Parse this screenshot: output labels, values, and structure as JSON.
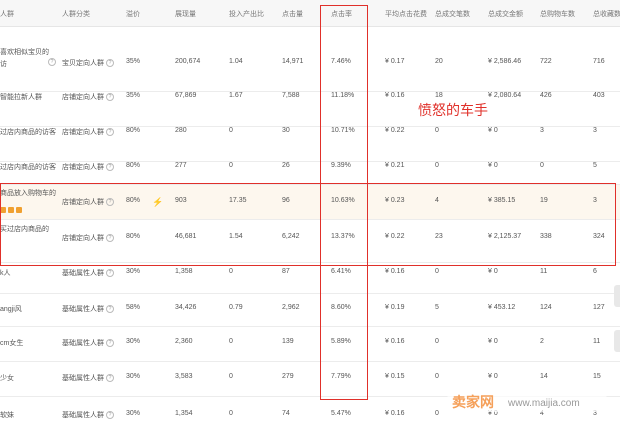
{
  "headers": {
    "audience": "人群",
    "audience_type": "人群分类",
    "premium": "溢价",
    "impressions": "展现量",
    "roi": "投入产出比",
    "clicks": "点击量",
    "ctr": "点击率",
    "avg_cpc": "平均点击花费",
    "total_deals": "总成交笔数",
    "total_amount": "总成交金额",
    "total_cart": "总购物车数",
    "total_fav": "总收藏数"
  },
  "rows": [
    {
      "name1": "喜欢相似宝贝的",
      "name2": "访",
      "type": "宝贝定向人群",
      "premium": "35%",
      "impressions": "200,674",
      "roi": "1.04",
      "clicks": "14,971",
      "ctr": "7.46%",
      "cpc": "¥ 0.17",
      "deals": "20",
      "amount": "¥ 2,586.46",
      "cart": "722",
      "fav": "716"
    },
    {
      "name1": "智能拉新人群",
      "name2": "",
      "type": "店铺定向人群",
      "premium": "35%",
      "impressions": "67,869",
      "roi": "1.67",
      "clicks": "7,588",
      "ctr": "11.18%",
      "cpc": "¥ 0.16",
      "deals": "18",
      "amount": "¥ 2,080.64",
      "cart": "426",
      "fav": "403"
    },
    {
      "name1": "过店内商品的访客",
      "name2": "",
      "type": "店铺定向人群",
      "premium": "80%",
      "impressions": "280",
      "roi": "0",
      "clicks": "30",
      "ctr": "10.71%",
      "cpc": "¥ 0.22",
      "deals": "0",
      "amount": "¥ 0",
      "cart": "3",
      "fav": "3"
    },
    {
      "name1": "过店内商品的访客",
      "name2": "",
      "type": "店铺定向人群",
      "premium": "80%",
      "impressions": "277",
      "roi": "0",
      "clicks": "26",
      "ctr": "9.39%",
      "cpc": "¥ 0.21",
      "deals": "0",
      "amount": "¥ 0",
      "cart": "0",
      "fav": "5"
    },
    {
      "name1": "商品放入购物车的",
      "name2": "",
      "type": "店铺定向人群",
      "premium": "80%",
      "impressions": "903",
      "roi": "17.35",
      "clicks": "96",
      "ctr": "10.63%",
      "cpc": "¥ 0.23",
      "deals": "4",
      "amount": "¥ 385.15",
      "cart": "19",
      "fav": "3"
    },
    {
      "name1": "买过店内商品的",
      "name2": "",
      "type": "店铺定向人群",
      "premium": "80%",
      "impressions": "46,681",
      "roi": "1.54",
      "clicks": "6,242",
      "ctr": "13.37%",
      "cpc": "¥ 0.22",
      "deals": "23",
      "amount": "¥ 2,125.37",
      "cart": "338",
      "fav": "324"
    },
    {
      "name1": "k人",
      "name2": "",
      "type": "基础属性人群",
      "premium": "30%",
      "impressions": "1,358",
      "roi": "0",
      "clicks": "87",
      "ctr": "6.41%",
      "cpc": "¥ 0.16",
      "deals": "0",
      "amount": "¥ 0",
      "cart": "11",
      "fav": "6"
    },
    {
      "name1": "angji风",
      "name2": "",
      "type": "基础属性人群",
      "premium": "58%",
      "impressions": "34,426",
      "roi": "0.79",
      "clicks": "2,962",
      "ctr": "8.60%",
      "cpc": "¥ 0.19",
      "deals": "5",
      "amount": "¥ 453.12",
      "cart": "124",
      "fav": "127"
    },
    {
      "name1": "cm女生",
      "name2": "",
      "type": "基础属性人群",
      "premium": "30%",
      "impressions": "2,360",
      "roi": "0",
      "clicks": "139",
      "ctr": "5.89%",
      "cpc": "¥ 0.16",
      "deals": "0",
      "amount": "¥ 0",
      "cart": "2",
      "fav": "11"
    },
    {
      "name1": "少女",
      "name2": "",
      "type": "基础属性人群",
      "premium": "30%",
      "impressions": "3,583",
      "roi": "0",
      "clicks": "279",
      "ctr": "7.79%",
      "cpc": "¥ 0.15",
      "deals": "0",
      "amount": "¥ 0",
      "cart": "14",
      "fav": "15"
    },
    {
      "name1": "软妹",
      "name2": "",
      "type": "基础属性人群",
      "premium": "30%",
      "impressions": "1,354",
      "roi": "0",
      "clicks": "74",
      "ctr": "5.47%",
      "cpc": "¥ 0.16",
      "deals": "0",
      "amount": "¥ 0",
      "cart": "4",
      "fav": "3"
    }
  ],
  "annotation": "愤怒的车手",
  "watermark": {
    "logo": "卖家网",
    "url": "www.maijia.com"
  },
  "colors": {
    "annotation_red": "#e0302a",
    "highlight_bg": "#fdf7ee",
    "watermark_orange": "#f5a05a"
  }
}
